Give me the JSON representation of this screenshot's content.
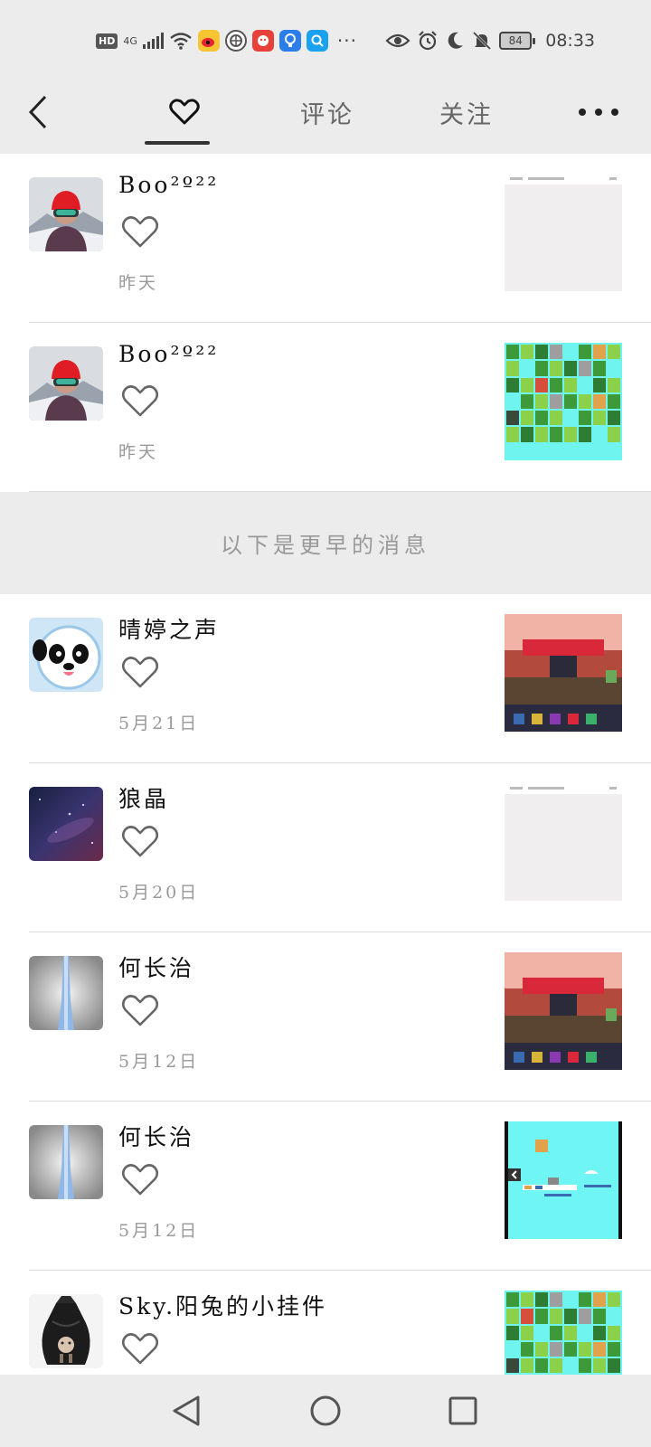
{
  "status_bar": {
    "hd": "HD",
    "network": "4G",
    "battery": "84",
    "time": "08:33",
    "icons": [
      "signal-icon",
      "wifi-icon",
      "weibo-icon",
      "aperture-app-icon",
      "app-red-icon",
      "bulb-app-icon",
      "search-app-icon",
      "eye-icon",
      "alarm-icon",
      "moon-icon",
      "bell-off-icon"
    ],
    "more_dots": "···"
  },
  "header": {
    "tabs": [
      {
        "label": "♡",
        "icon": "heart-icon",
        "active": true
      },
      {
        "label": "评论",
        "active": false
      },
      {
        "label": "关注",
        "active": false
      }
    ]
  },
  "notifications_recent": [
    {
      "name": "Boo²º²²",
      "time": "昨天",
      "thumb": "blank",
      "avatar": "climber"
    },
    {
      "name": "Boo²º²²",
      "time": "昨天",
      "thumb": "grid",
      "avatar": "climber"
    }
  ],
  "earlier_label": "以下是更早的消息",
  "notifications_earlier": [
    {
      "name": "晴婷之声",
      "time": "5月21日",
      "thumb": "game",
      "avatar": "panda"
    },
    {
      "name": "狼晶",
      "time": "5月20日",
      "thumb": "blank",
      "avatar": "galaxy"
    },
    {
      "name": "何长治",
      "time": "5月12日",
      "thumb": "game",
      "avatar": "tower"
    },
    {
      "name": "何长治",
      "time": "5月12日",
      "thumb": "cyan",
      "avatar": "tower"
    },
    {
      "name": "Sky.阳兔的小挂件",
      "time": "",
      "thumb": "grid",
      "avatar": "bag"
    }
  ],
  "colors": {
    "background": "#ececec",
    "list_bg": "#ffffff",
    "heart_stroke": "#666666",
    "time_text": "#999999"
  }
}
